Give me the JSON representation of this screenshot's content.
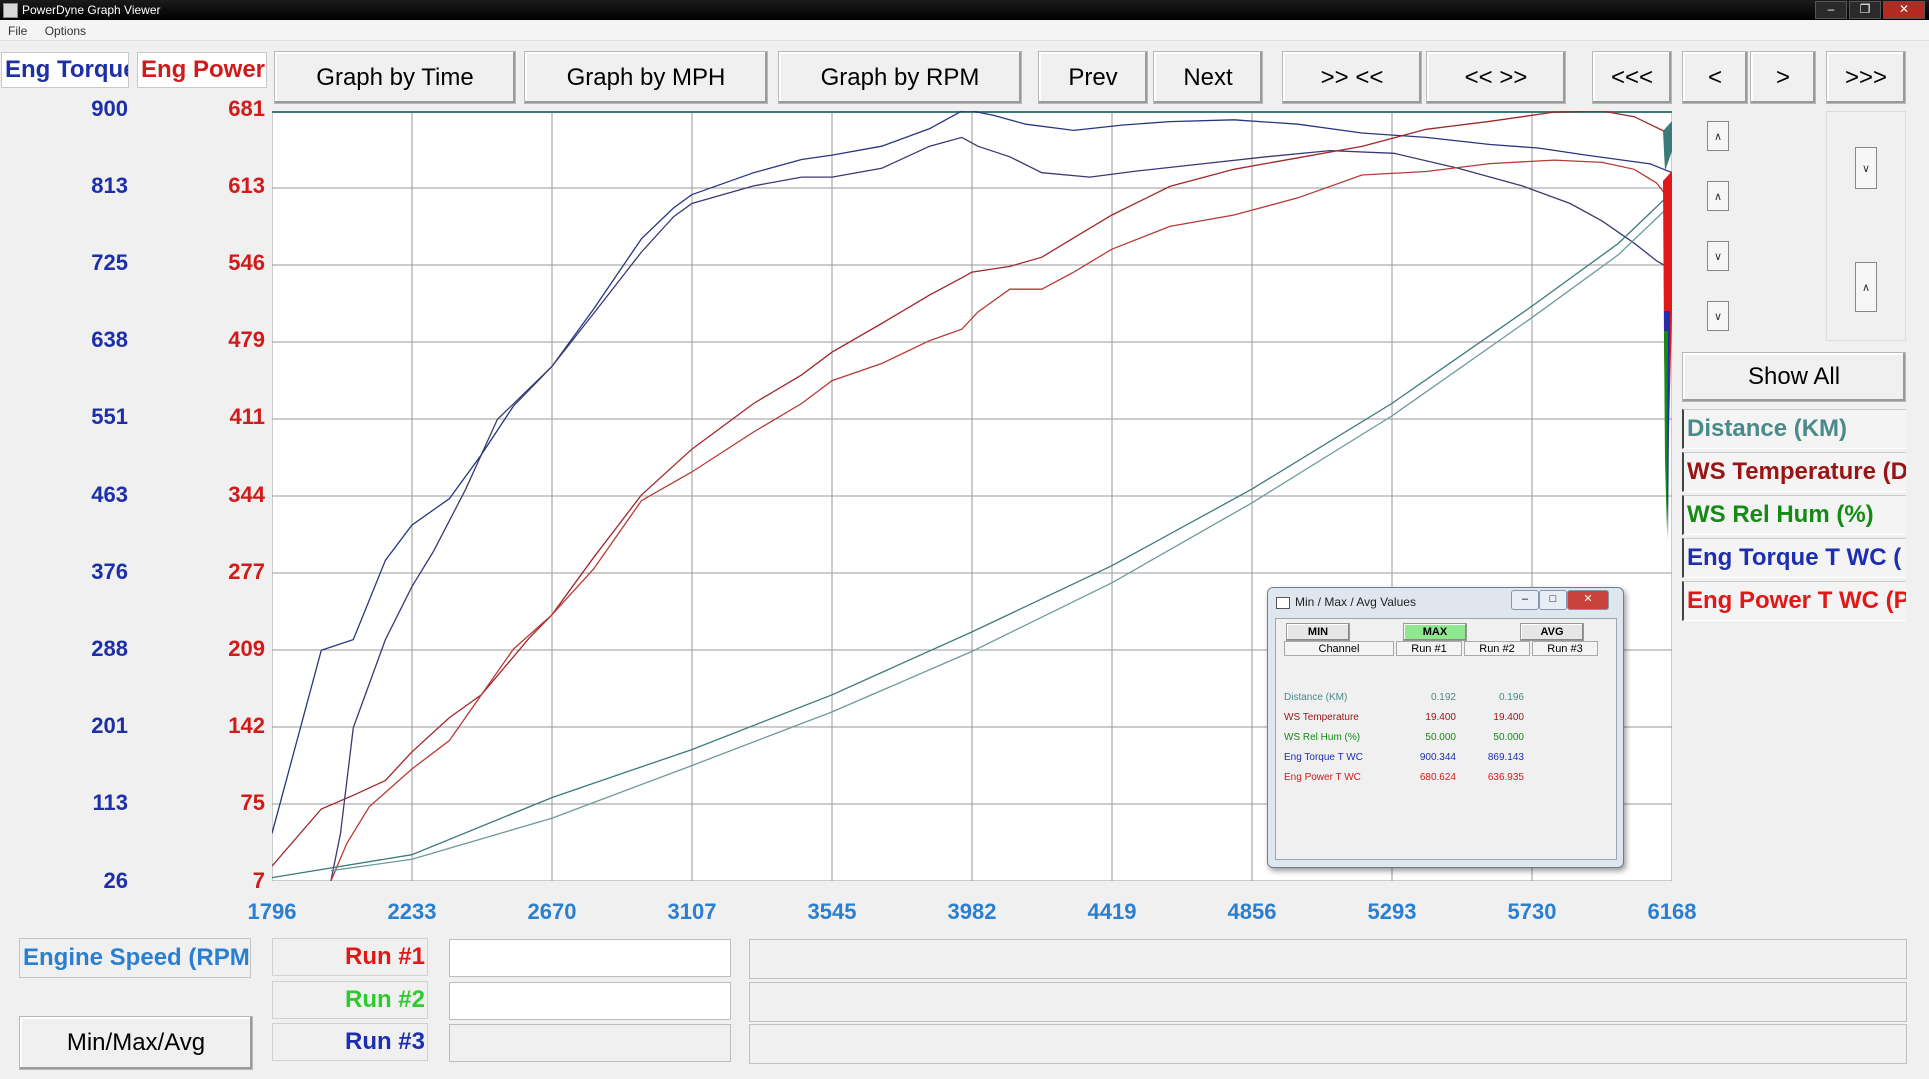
{
  "window": {
    "title": "PowerDyne Graph Viewer",
    "minimize": "–",
    "restore": "❐",
    "close": "✕"
  },
  "menu": [
    "File",
    "Options"
  ],
  "axis_headers": {
    "left": "Eng Torque",
    "right": "Eng Power"
  },
  "toolbar": {
    "graph_by_time": "Graph by Time",
    "graph_by_mph": "Graph by MPH",
    "graph_by_rpm": "Graph by RPM",
    "prev": "Prev",
    "next": "Next",
    "zoom_in": ">> <<",
    "zoom_out": "<< >>",
    "far_left": "<<<",
    "left": "<",
    "right": ">",
    "far_right": ">>>"
  },
  "side_controls": {
    "show_all": "Show All"
  },
  "legend": [
    {
      "label": "Distance (KM)",
      "color": "#4a8a8a"
    },
    {
      "label": "WS Temperature (D",
      "color": "#9a1414"
    },
    {
      "label": "WS Rel Hum (%)",
      "color": "#158a15"
    },
    {
      "label": "Eng Torque T WC (",
      "color": "#1d2fb0"
    },
    {
      "label": "Eng Power T WC (P",
      "color": "#e01818"
    }
  ],
  "x_axis": {
    "label": "Engine Speed (RPM",
    "ticks": [
      "1796",
      "2233",
      "2670",
      "3107",
      "3545",
      "3982",
      "4419",
      "4856",
      "5293",
      "5730",
      "6168"
    ]
  },
  "y_torque_ticks": [
    "900",
    "813",
    "725",
    "638",
    "551",
    "463",
    "376",
    "288",
    "201",
    "113",
    "26"
  ],
  "y_power_ticks": [
    "681",
    "613",
    "546",
    "479",
    "411",
    "344",
    "277",
    "209",
    "142",
    "75",
    "7"
  ],
  "runs": [
    {
      "label": "Run #1",
      "color": "#e01818"
    },
    {
      "label": "Run #2",
      "color": "#2ecb2e"
    },
    {
      "label": "Run #3",
      "color": "#1d2fb0"
    }
  ],
  "minmax_button": "Min/Max/Avg",
  "dialog": {
    "title": "Min / Max / Avg Values",
    "tabs": {
      "min": "MIN",
      "max": "MAX",
      "avg": "AVG"
    },
    "headers": [
      "Channel",
      "Run #1",
      "Run #2",
      "Run #3"
    ],
    "rows": [
      {
        "channel": "Distance (KM)",
        "run1": "0.192",
        "run2": "0.196",
        "run3": "",
        "color": "#4a8a8a"
      },
      {
        "channel": "WS Temperature",
        "run1": "19.400",
        "run2": "19.400",
        "run3": "",
        "color": "#9a1414"
      },
      {
        "channel": "WS Rel Hum (%)",
        "run1": "50.000",
        "run2": "50.000",
        "run3": "",
        "color": "#158a15"
      },
      {
        "channel": "Eng Torque T WC",
        "run1": "900.344",
        "run2": "869.143",
        "run3": "",
        "color": "#1d2fb0"
      },
      {
        "channel": "Eng Power T WC",
        "run1": "680.624",
        "run2": "636.935",
        "run3": "",
        "color": "#d11a1a"
      }
    ]
  },
  "chart_data": {
    "type": "line",
    "x_label": "Engine Speed (RPM",
    "x_range": [
      1796,
      6168
    ],
    "y_torque_range": [
      26,
      900
    ],
    "y_power_range": [
      7,
      681
    ],
    "series": [
      {
        "name": "Eng Torque T WC",
        "run": "Run #1",
        "axis": "torque",
        "color": "#2a3580",
        "x": [
          1796,
          1950,
          2050,
          2150,
          2233,
          2350,
          2450,
          2550,
          2670,
          2800,
          2950,
          3050,
          3107,
          3300,
          3450,
          3545,
          3700,
          3850,
          3950,
          3982,
          4050,
          4150,
          4300,
          4450,
          4600,
          4800,
          5000,
          5200,
          5400,
          5600,
          5750,
          5900,
          6000,
          6100,
          6168
        ],
        "y": [
          80,
          288,
          300,
          390,
          430,
          460,
          510,
          565,
          610,
          675,
          755,
          790,
          805,
          830,
          845,
          850,
          860,
          880,
          900,
          900,
          895,
          885,
          878,
          884,
          888,
          890,
          885,
          875,
          870,
          862,
          858,
          850,
          845,
          840,
          830
        ]
      },
      {
        "name": "Eng Torque T WC",
        "run": "Run #2",
        "axis": "torque",
        "color": "#3a3a70",
        "x": [
          1980,
          2010,
          2050,
          2150,
          2233,
          2300,
          2400,
          2500,
          2670,
          2800,
          2950,
          3050,
          3107,
          3300,
          3450,
          3545,
          3700,
          3850,
          3950,
          4000,
          4100,
          4200,
          4350,
          4500,
          4700,
          4900,
          5100,
          5300,
          5500,
          5700,
          5850,
          5950,
          6050,
          6120,
          6168
        ],
        "y": [
          26,
          80,
          200,
          300,
          360,
          400,
          470,
          550,
          610,
          670,
          740,
          780,
          795,
          815,
          825,
          825,
          835,
          860,
          870,
          860,
          848,
          830,
          825,
          832,
          840,
          848,
          855,
          852,
          835,
          815,
          795,
          775,
          750,
          730,
          720
        ]
      },
      {
        "name": "Eng Power T WC",
        "run": "Run #1",
        "axis": "power",
        "color": "#a0262c",
        "x": [
          1796,
          1950,
          2050,
          2150,
          2233,
          2350,
          2450,
          2600,
          2670,
          2800,
          2950,
          3107,
          3300,
          3450,
          3545,
          3700,
          3850,
          3950,
          3982,
          4100,
          4200,
          4300,
          4419,
          4600,
          4800,
          5000,
          5200,
          5400,
          5600,
          5800,
          5950,
          6050,
          6168
        ],
        "y": [
          20,
          70,
          82,
          95,
          120,
          150,
          170,
          220,
          240,
          290,
          345,
          385,
          425,
          450,
          470,
          495,
          520,
          535,
          540,
          545,
          553,
          570,
          590,
          615,
          630,
          640,
          650,
          665,
          672,
          680,
          681,
          676,
          660
        ]
      },
      {
        "name": "Eng Power T WC",
        "run": "Run #2",
        "axis": "power",
        "color": "#b73a36",
        "x": [
          1980,
          2030,
          2100,
          2233,
          2350,
          2450,
          2550,
          2670,
          2800,
          2950,
          3107,
          3300,
          3450,
          3545,
          3700,
          3850,
          3950,
          4000,
          4100,
          4200,
          4300,
          4419,
          4600,
          4800,
          5000,
          5200,
          5400,
          5600,
          5800,
          5950,
          6050,
          6120,
          6168
        ],
        "y": [
          7,
          40,
          72,
          105,
          130,
          170,
          210,
          240,
          280,
          340,
          365,
          400,
          425,
          445,
          460,
          480,
          490,
          505,
          525,
          525,
          540,
          560,
          580,
          590,
          605,
          625,
          628,
          635,
          638,
          636,
          630,
          618,
          600
        ]
      },
      {
        "name": "Distance (KM)",
        "run": "Run #1",
        "axis": "power",
        "color": "#3c7a7a",
        "x": [
          1796,
          2233,
          2670,
          3107,
          3545,
          3982,
          4419,
          4856,
          5293,
          5730,
          6000,
          6168
        ],
        "y": [
          10,
          30,
          80,
          122,
          170,
          225,
          283,
          350,
          425,
          510,
          565,
          610
        ]
      },
      {
        "name": "Distance (KM)",
        "run": "Run #2",
        "axis": "power",
        "color": "#6e9a9a",
        "x": [
          1980,
          2233,
          2670,
          3107,
          3545,
          3982,
          4419,
          4856,
          5293,
          5730,
          6000,
          6168
        ],
        "y": [
          16,
          26,
          62,
          108,
          155,
          208,
          268,
          338,
          414,
          500,
          555,
          600
        ]
      }
    ]
  }
}
